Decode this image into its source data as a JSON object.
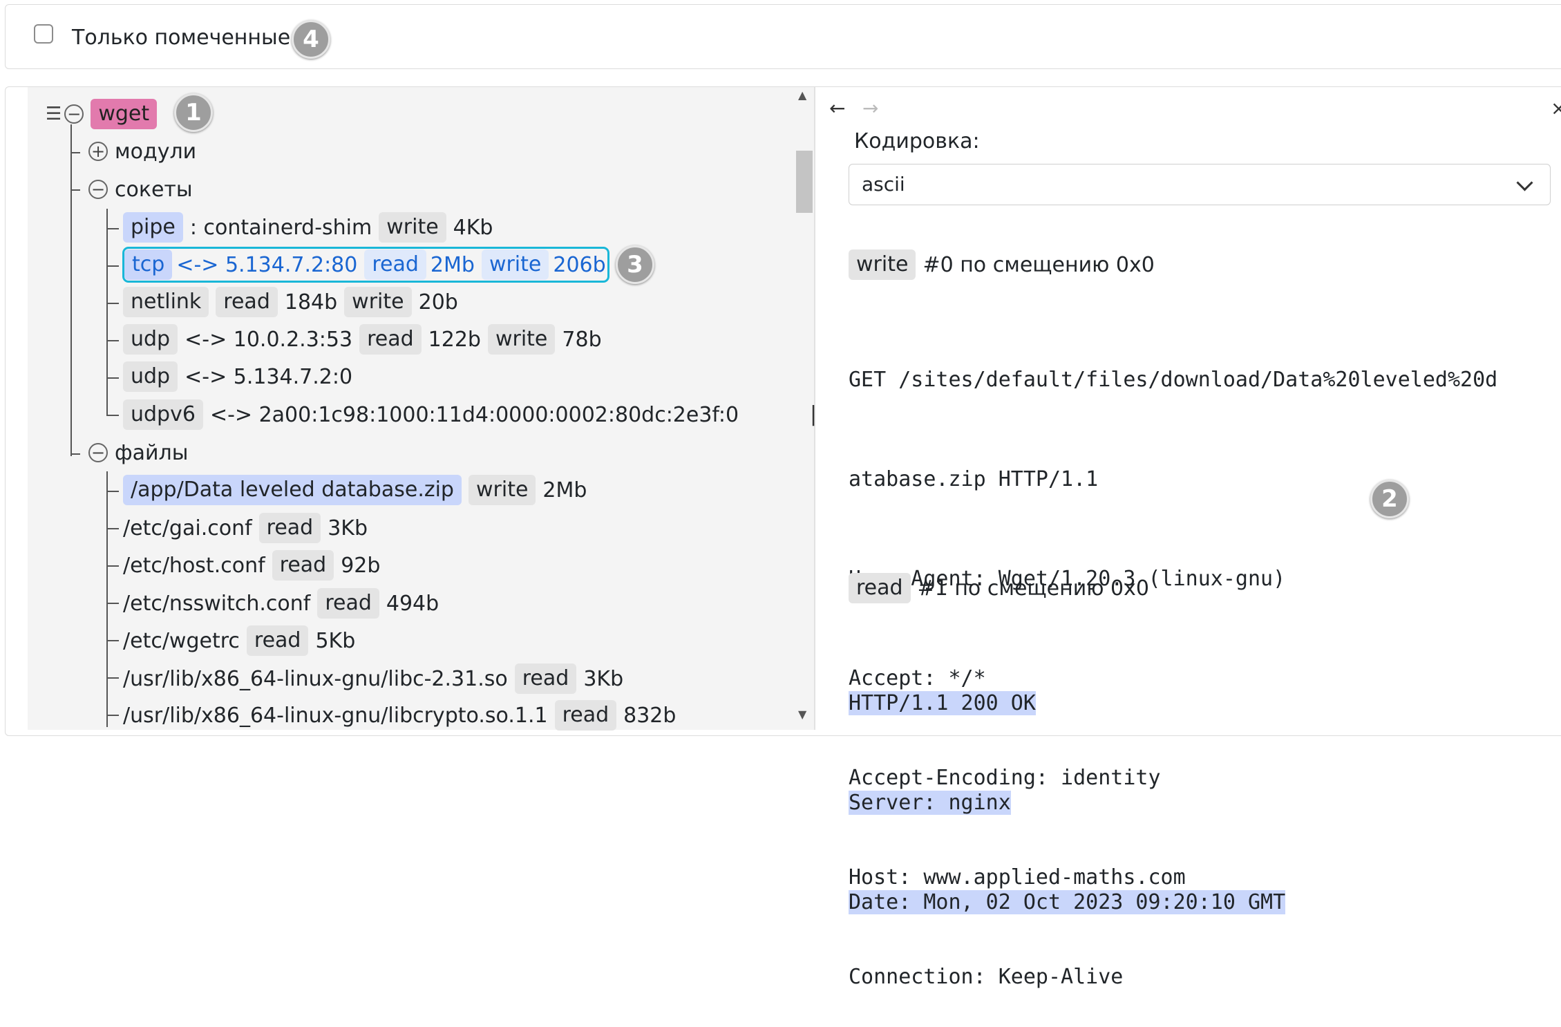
{
  "filter": {
    "label": "Только помеченные",
    "checked": false,
    "badge": "4"
  },
  "tree": {
    "root": {
      "label": "wget",
      "badge": "1"
    },
    "groups": {
      "modules": "модули",
      "sockets": "сокеты",
      "files": "файлы"
    },
    "sockets": [
      {
        "type": "pipe",
        "peer": ": containerd-shim",
        "ops": [
          {
            "op": "write",
            "size": "4Kb"
          }
        ]
      },
      {
        "type": "tcp",
        "peer": "<-> 5.134.7.2:80",
        "ops": [
          {
            "op": "read",
            "size": "2Mb"
          },
          {
            "op": "write",
            "size": "206b"
          }
        ],
        "selected": true,
        "badge": "3"
      },
      {
        "type": "netlink",
        "peer": "",
        "ops": [
          {
            "op": "read",
            "size": "184b"
          },
          {
            "op": "write",
            "size": "20b"
          }
        ]
      },
      {
        "type": "udp",
        "peer": "<-> 10.0.2.3:53",
        "ops": [
          {
            "op": "read",
            "size": "122b"
          },
          {
            "op": "write",
            "size": "78b"
          }
        ]
      },
      {
        "type": "udp",
        "peer": "<-> 5.134.7.2:0",
        "ops": []
      },
      {
        "type": "udpv6",
        "peer": "<-> 2a00:1c98:1000:11d4:0000:0002:80dc:2e3f:0",
        "ops": []
      }
    ],
    "files": [
      {
        "path": "/app/Data leveled database.zip",
        "op": "write",
        "size": "2Mb",
        "highlighted": true
      },
      {
        "path": "/etc/gai.conf",
        "op": "read",
        "size": "3Kb"
      },
      {
        "path": "/etc/host.conf",
        "op": "read",
        "size": "92b"
      },
      {
        "path": "/etc/nsswitch.conf",
        "op": "read",
        "size": "494b"
      },
      {
        "path": "/etc/wgetrc",
        "op": "read",
        "size": "5Kb"
      },
      {
        "path": "/usr/lib/x86_64-linux-gnu/libc-2.31.so",
        "op": "read",
        "size": "3Kb"
      },
      {
        "path": "/usr/lib/x86_64-linux-gnu/libcrypto.so.1.1",
        "op": "read",
        "size": "832b"
      }
    ]
  },
  "detail": {
    "nav": {
      "back": "←",
      "forward": "→",
      "close": "×"
    },
    "encoding_label": "Кодировка:",
    "encoding_value": "ascii",
    "badge": "2",
    "write_block": {
      "op": "write",
      "title": "#0 по смещению 0x0",
      "lines": [
        "GET /sites/default/files/download/Data%20leveled%20d",
        "atabase.zip HTTP/1.1",
        "User-Agent: Wget/1.20.3 (linux-gnu)",
        "Accept: */*",
        "Accept-Encoding: identity",
        "Host: www.applied-maths.com",
        "Connection: Keep-Alive"
      ]
    },
    "read_block": {
      "op": "read",
      "title": "#1 по смещению 0x0",
      "lines": [
        "HTTP/1.1 200 OK",
        "Server: nginx",
        "Date: Mon, 02 Oct 2023 09:20:10 GMT"
      ]
    }
  }
}
